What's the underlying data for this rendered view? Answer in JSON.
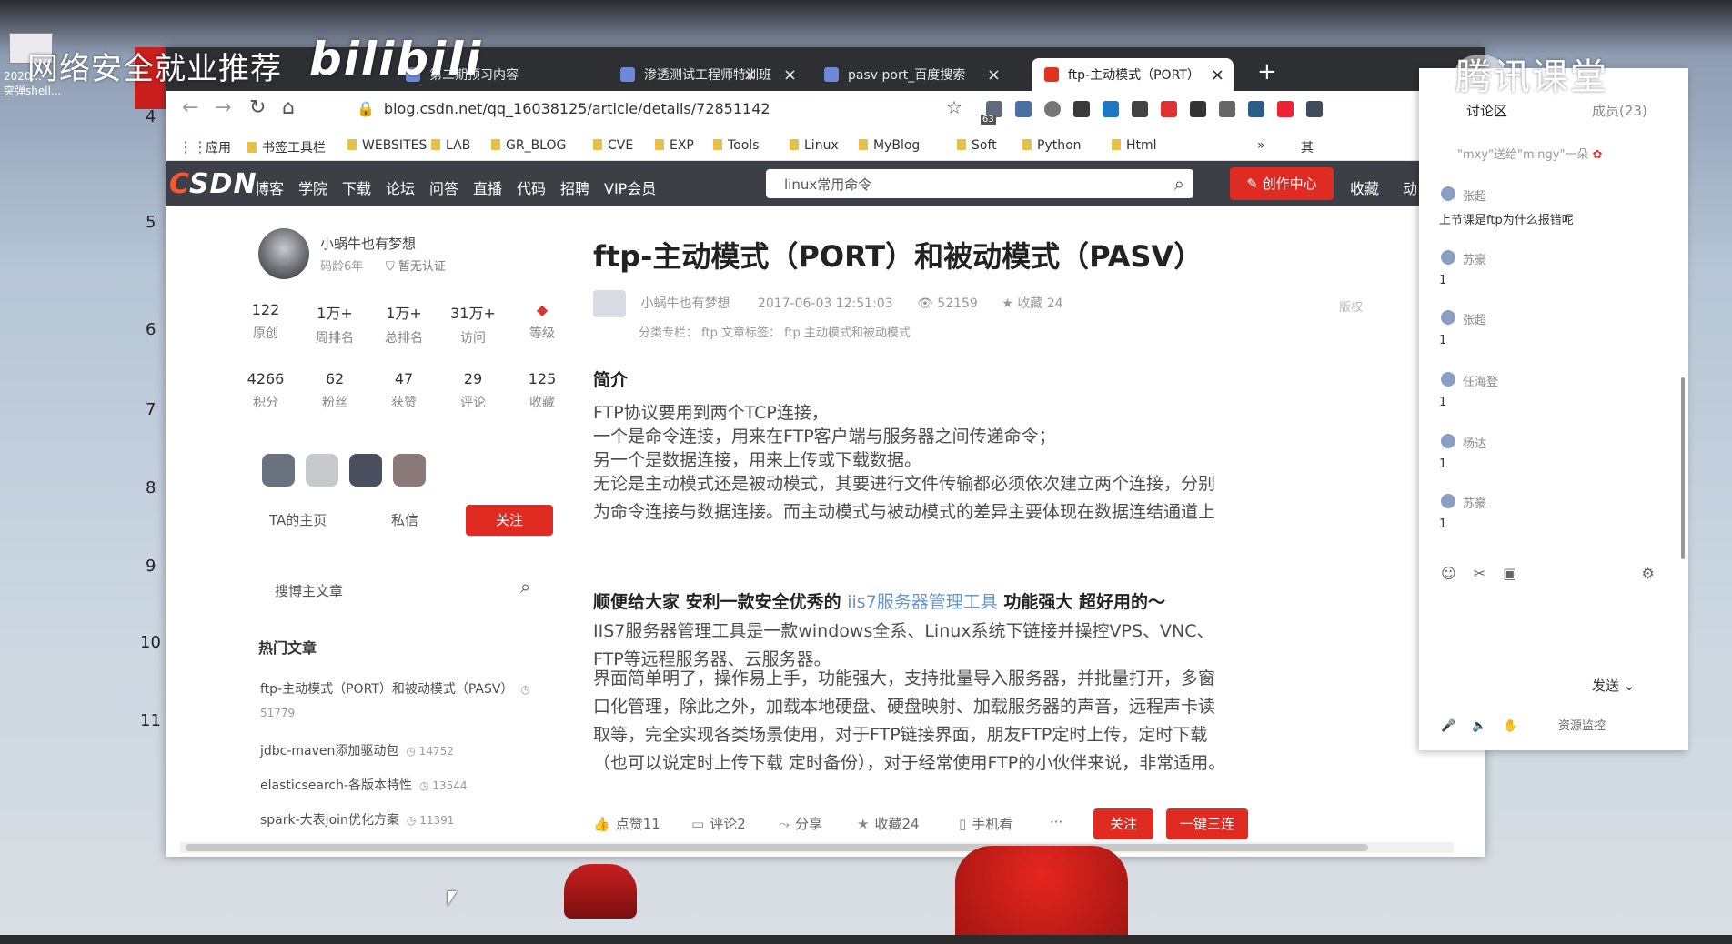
{
  "overlay": {
    "watermark_left": "网络安全就业推荐",
    "watermark_bili": "bilibili",
    "watermark_tencent": "腾讯课堂",
    "desktop_label": "2020...\n突弹shell..."
  },
  "ruler": [
    "4",
    "5",
    "6",
    "7",
    "8",
    "9",
    "10",
    "11"
  ],
  "browser": {
    "tabs": [
      {
        "label": "第二期预习内容"
      },
      {
        "label": "渗透测试工程师特训班"
      },
      {
        "label": "pasv port_百度搜索"
      },
      {
        "label": "ftp-主动模式（PORT）"
      }
    ],
    "new_tab": "+",
    "url": "blog.csdn.net/qq_16038125/article/details/72851142",
    "ext_badge": "63",
    "bookmarks": [
      "应用",
      "书签工具栏",
      "WEBSITES",
      "LAB",
      "GR_BLOG",
      "CVE",
      "EXP",
      "Tools",
      "Linux",
      "MyBlog",
      "Soft",
      "Python",
      "Html",
      "»",
      "其"
    ]
  },
  "csdn": {
    "logo_c": "C",
    "logo_rest": "SDN",
    "nav": [
      "博客",
      "学院",
      "下载",
      "论坛",
      "问答",
      "直播",
      "代码",
      "招聘",
      "VIP会员"
    ],
    "search_text": "linux常用命令",
    "create_btn": "创作中心",
    "nav_right": [
      "收藏",
      "动"
    ]
  },
  "sidebar": {
    "author": "小蜗牛也有梦想",
    "age": "码龄6年",
    "cert": "暂无认证",
    "stats_row1": [
      {
        "num": "122",
        "label": "原创"
      },
      {
        "num": "1万+",
        "label": "周排名"
      },
      {
        "num": "1万+",
        "label": "总排名"
      },
      {
        "num": "31万+",
        "label": "访问"
      },
      {
        "num": "",
        "label": "等级"
      }
    ],
    "stats_row2": [
      {
        "num": "4266",
        "label": "积分"
      },
      {
        "num": "62",
        "label": "粉丝"
      },
      {
        "num": "47",
        "label": "获赞"
      },
      {
        "num": "29",
        "label": "评论"
      },
      {
        "num": "125",
        "label": "收藏"
      }
    ],
    "ta_home": "TA的主页",
    "private_msg": "私信",
    "follow": "关注",
    "search_placeholder": "搜博主文章",
    "hot_title": "热门文章",
    "hot": [
      {
        "title": "ftp-主动模式（PORT）和被动模式（PASV）",
        "views": "51779"
      },
      {
        "title": "jdbc-maven添加驱动包",
        "views": "14752"
      },
      {
        "title": "elasticsearch-各版本特性",
        "views": "13544"
      },
      {
        "title": "spark-大表join优化方案",
        "views": "11391"
      }
    ]
  },
  "article": {
    "title": "ftp-主动模式（PORT）和被动模式（PASV）",
    "meta_author": "小蜗牛也有梦想",
    "meta_date": "2017-06-03 12:51:03",
    "meta_views": "52159",
    "meta_collect": "收藏 24",
    "copyright": "版权",
    "tags_line": "分类专栏： ftp   文章标签： ftp   主动模式和被动模式",
    "section_intro": "简介",
    "para1": "FTP协议要用到两个TCP连接，",
    "para2": "一个是命令连接，用来在FTP客户端与服务器之间传递命令；",
    "para3": "另一个是数据连接，用来上传或下载数据。",
    "para4": "无论是主动模式还是被动模式，其要进行文件传输都必须依次建立两个连接，分别为命令连接与数据连接。而主动模式与被动模式的差异主要体现在数据连结通道上",
    "promo_a": "顺便给大家 安利一款安全优秀的",
    "promo_link": "iis7服务器管理工具",
    "promo_b": "功能强大 超好用的～",
    "para5": "IIS7服务器管理工具是一款windows全系、Linux系统下链接并操控VPS、VNC、FTP等远程服务器、云服务器。",
    "para6": "界面简单明了，操作易上手，功能强大，支持批量导入服务器，并批量打开，多窗口化管理，除此之外，加载本地硬盘、硬盘映射、加载服务器的声音，远程声卡读取等，完全实现各类场景使用，对于FTP链接界面，朋友FTP定时上传，定时下载（也可以说定时上传下载 定时备份），对于经常使用FTP的小伙伴来说，非常适用。",
    "actions": {
      "like": "点赞11",
      "comment": "评论2",
      "share": "分享",
      "collect": "收藏24",
      "mobile": "手机看",
      "more": "···",
      "follow": "关注",
      "triple": "一键三连"
    }
  },
  "chat": {
    "tab_discussion": "讨论区",
    "tab_members": "成员(23)",
    "banner": "\"mxy\"送给\"mingy\"一朵",
    "messages": [
      {
        "name": "张超",
        "text": "上节课是ftp为什么报错呢"
      },
      {
        "name": "苏豪",
        "text": "1"
      },
      {
        "name": "张超",
        "text": "1"
      },
      {
        "name": "任海登",
        "text": "1"
      },
      {
        "name": "杨达",
        "text": "1"
      },
      {
        "name": "苏豪",
        "text": "1"
      }
    ],
    "send": "发送",
    "bottom": "资源监控"
  }
}
